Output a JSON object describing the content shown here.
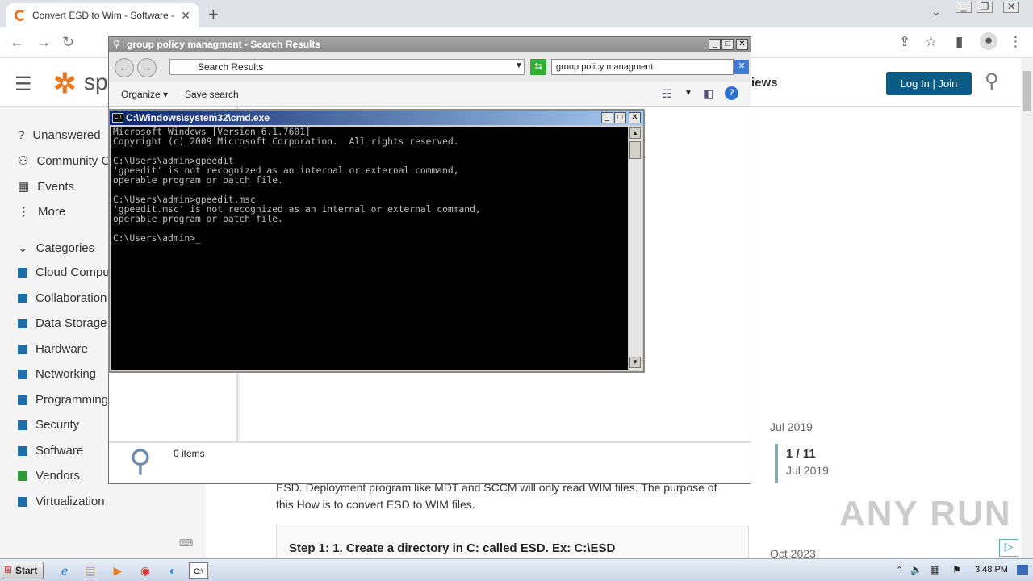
{
  "browser": {
    "tab_title": "Convert ESD to Wim - Software - Sp",
    "close_glyph": "✕",
    "newtab_glyph": "+"
  },
  "site": {
    "logo": "sp",
    "header_fragment": "iews",
    "login_label": "Log In | Join",
    "sidebar": [
      {
        "icon": "question-icon",
        "label": "Unanswered"
      },
      {
        "icon": "people-icon",
        "label": "Community G"
      },
      {
        "icon": "calendar-icon",
        "label": "Events"
      },
      {
        "icon": "more-icon",
        "label": "More"
      }
    ],
    "categories_heading": "Categories",
    "categories": [
      {
        "label": "Cloud Compu",
        "color": "#1e6fa8"
      },
      {
        "label": "Collaboration",
        "color": "#1e6fa8"
      },
      {
        "label": "Data Storage",
        "color": "#1e6fa8"
      },
      {
        "label": "Hardware",
        "color": "#1e6fa8"
      },
      {
        "label": "Networking",
        "color": "#1e6fa8"
      },
      {
        "label": "Programming",
        "color": "#1e6fa8"
      },
      {
        "label": "Security",
        "color": "#1e6fa8"
      },
      {
        "label": "Software",
        "color": "#1e6fa8"
      },
      {
        "label": "Vendors",
        "color": "#2e9a3c"
      },
      {
        "label": "Virtualization",
        "color": "#1e6fa8"
      }
    ],
    "timeline": {
      "top_date": "Jul 2019",
      "counter": "1 / 11",
      "counter_date": "Jul 2019",
      "bottom_date": "Oct 2023"
    },
    "body_text_1": "ESD. Deployment program like MDT and SCCM will only read WIM files. The purpose of",
    "body_text_2": "this How is to convert ESD to WIM files.",
    "step_heading": "Step 1: 1. Create a directory in C: called ESD. Ex: C:\\ESD"
  },
  "explorer": {
    "title": "group policy managment - Search Results",
    "address": "Search Results",
    "search_value": "group policy managment",
    "organize_label": "Organize",
    "save_search_label": "Save search",
    "status_text": "0 items"
  },
  "cmd": {
    "title": "C:\\Windows\\system32\\cmd.exe",
    "output": "Microsoft Windows [Version 6.1.7601]\nCopyright (c) 2009 Microsoft Corporation.  All rights reserved.\n\nC:\\Users\\admin>gpeedit\n'gpeedit' is not recognized as an internal or external command,\noperable program or batch file.\n\nC:\\Users\\admin>gpeedit.msc\n'gpeedit.msc' is not recognized as an internal or external command,\noperable program or batch file.\n\nC:\\Users\\admin>_"
  },
  "taskbar": {
    "start_label": "Start",
    "clock": "3:48 PM"
  },
  "watermark": "ANY RUN"
}
